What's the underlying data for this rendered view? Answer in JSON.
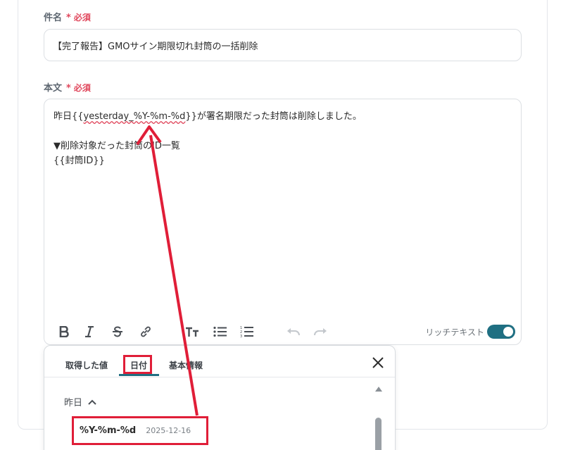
{
  "subject": {
    "label": "件名",
    "required": "必須",
    "value": "【完了報告】GMOサイン期限切れ封筒の一括削除"
  },
  "body": {
    "label": "本文",
    "required": "必須",
    "line1_prefix": "昨日{{",
    "line1_var": "yesterday_%Y-%m-%d",
    "line1_suffix": "}}が署名期限だった封筒は削除しました。",
    "line2": "▼削除対象だった封筒のID一覧",
    "line3": "{{封筒ID}}"
  },
  "toolbar": {
    "rich_text_label": "リッチテキスト",
    "rich_text_enabled": true,
    "icons": [
      "bold-icon",
      "italic-icon",
      "strikethrough-icon",
      "link-icon",
      "text-size-icon",
      "bullet-list-icon",
      "numbered-list-icon",
      "undo-icon",
      "redo-icon"
    ]
  },
  "popup": {
    "tabs": [
      "取得した値",
      "日付",
      "基本情報"
    ],
    "active_tab": "日付",
    "section": "昨日",
    "item": {
      "format": "%Y-%m-%d",
      "example": "2025-12-16"
    }
  },
  "colors": {
    "accent": "#1f6f82",
    "highlight": "#e01e38",
    "required": "#e0475c"
  }
}
